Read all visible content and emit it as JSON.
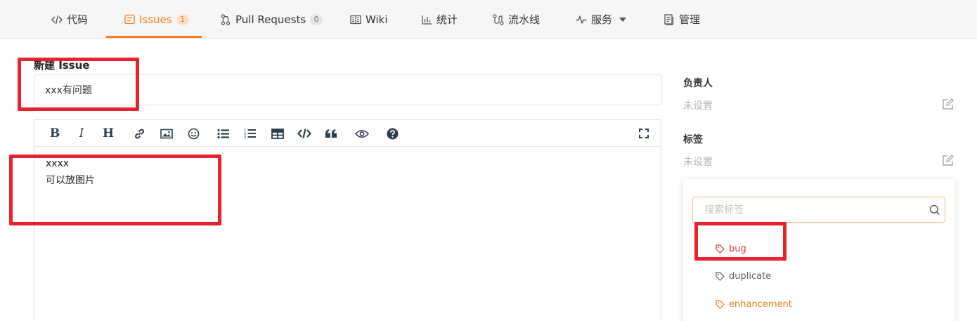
{
  "tabs": [
    {
      "label": "代码",
      "icon": "code-icon"
    },
    {
      "label": "Issues",
      "count": "1",
      "icon": "issues-icon",
      "active": true
    },
    {
      "label": "Pull Requests",
      "count": "0",
      "icon": "pull-request-icon"
    },
    {
      "label": "Wiki",
      "icon": "wiki-icon"
    },
    {
      "label": "统计",
      "icon": "stats-icon"
    },
    {
      "label": "流水线",
      "icon": "pipeline-icon"
    },
    {
      "label": "服务",
      "icon": "services-icon"
    },
    {
      "label": "管理",
      "icon": "manage-icon"
    }
  ],
  "form": {
    "title_label": "新建 Issue",
    "title_value": "xxx有问题",
    "body_line1": "xxxx",
    "body_line2": "可以放图片"
  },
  "toolbar": {
    "bold": "B",
    "italic": "I",
    "heading": "H"
  },
  "sidebar": {
    "assignee_label": "负责人",
    "assignee_value": "未设置",
    "labels_label": "标签",
    "labels_value": "未设置",
    "search_placeholder": "搜索标签",
    "label_options": [
      {
        "name": "bug",
        "color": "#d73a3a"
      },
      {
        "name": "duplicate",
        "color": "#606266"
      },
      {
        "name": "enhancement",
        "color": "#ef7c2a"
      }
    ]
  },
  "colors": {
    "accent": "#ff7a1a",
    "annotation": "#e8212e"
  }
}
